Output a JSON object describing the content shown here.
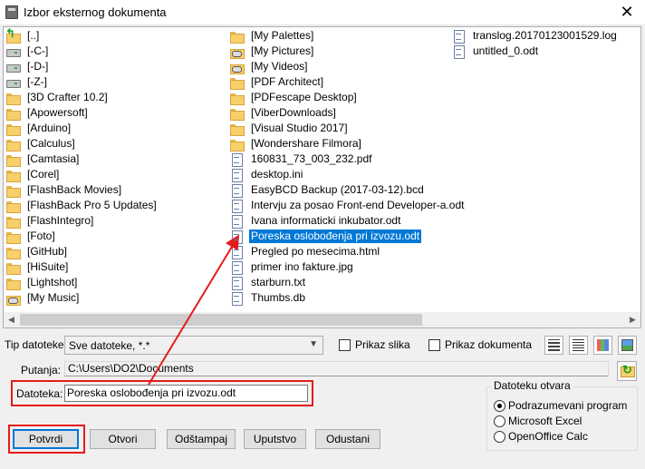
{
  "window": {
    "title": "Izbor eksternog dokumenta",
    "close_glyph": "✕"
  },
  "file_list": {
    "columns": [
      [
        {
          "label": "[..]",
          "icon": "folder-up-icon",
          "kind": "up"
        },
        {
          "label": "[-C-]",
          "icon": "drive-icon",
          "kind": "drive"
        },
        {
          "label": "[-D-]",
          "icon": "drive-icon",
          "kind": "drive"
        },
        {
          "label": "[-Z-]",
          "icon": "drive-icon",
          "kind": "drive"
        },
        {
          "label": "[3D Crafter 10.2]",
          "icon": "folder-icon",
          "kind": "folder"
        },
        {
          "label": "[Apowersoft]",
          "icon": "folder-icon",
          "kind": "folder"
        },
        {
          "label": "[Arduino]",
          "icon": "folder-icon",
          "kind": "folder"
        },
        {
          "label": "[Calculus]",
          "icon": "folder-icon",
          "kind": "folder"
        },
        {
          "label": "[Camtasia]",
          "icon": "folder-icon",
          "kind": "folder"
        },
        {
          "label": "[Corel]",
          "icon": "folder-icon",
          "kind": "folder"
        },
        {
          "label": "[FlashBack Movies]",
          "icon": "folder-icon",
          "kind": "folder"
        },
        {
          "label": "[FlashBack Pro 5 Updates]",
          "icon": "folder-icon",
          "kind": "folder"
        },
        {
          "label": "[FlashIntegro]",
          "icon": "folder-icon",
          "kind": "folder"
        },
        {
          "label": "[Foto]",
          "icon": "folder-icon",
          "kind": "folder"
        },
        {
          "label": "[GitHub]",
          "icon": "folder-icon",
          "kind": "folder"
        },
        {
          "label": "[HiSuite]",
          "icon": "folder-icon",
          "kind": "folder"
        },
        {
          "label": "[Lightshot]",
          "icon": "folder-icon",
          "kind": "folder"
        },
        {
          "label": "[My Music]",
          "icon": "special-folder-icon",
          "kind": "special"
        }
      ],
      [
        {
          "label": "[My Palettes]",
          "icon": "folder-icon",
          "kind": "folder"
        },
        {
          "label": "[My Pictures]",
          "icon": "special-folder-icon",
          "kind": "special"
        },
        {
          "label": "[My Videos]",
          "icon": "special-folder-icon",
          "kind": "special"
        },
        {
          "label": "[PDF Architect]",
          "icon": "folder-icon",
          "kind": "folder"
        },
        {
          "label": "[PDFescape Desktop]",
          "icon": "folder-icon",
          "kind": "folder"
        },
        {
          "label": "[ViberDownloads]",
          "icon": "folder-icon",
          "kind": "folder"
        },
        {
          "label": "[Visual Studio 2017]",
          "icon": "folder-icon",
          "kind": "folder"
        },
        {
          "label": "[Wondershare Filmora]",
          "icon": "folder-icon",
          "kind": "folder"
        },
        {
          "label": "160831_73_003_232.pdf",
          "icon": "file-icon",
          "kind": "file"
        },
        {
          "label": "desktop.ini",
          "icon": "file-icon",
          "kind": "file"
        },
        {
          "label": "EasyBCD Backup (2017-03-12).bcd",
          "icon": "file-icon",
          "kind": "file"
        },
        {
          "label": "Intervju za posao Front-end Developer-a.odt",
          "icon": "file-icon",
          "kind": "file"
        },
        {
          "label": "Ivana informaticki inkubator.odt",
          "icon": "file-icon",
          "kind": "file"
        },
        {
          "label": "Poreska oslobođenja pri izvozu.odt",
          "icon": "file-icon",
          "kind": "file",
          "selected": true
        },
        {
          "label": "Pregled po mesecima.html",
          "icon": "file-icon",
          "kind": "file"
        },
        {
          "label": "primer ino fakture.jpg",
          "icon": "file-icon",
          "kind": "file"
        },
        {
          "label": "starburn.txt",
          "icon": "file-icon",
          "kind": "file"
        },
        {
          "label": "Thumbs.db",
          "icon": "file-icon",
          "kind": "file"
        }
      ],
      [
        {
          "label": "translog.20170123001529.log",
          "icon": "file-icon",
          "kind": "file"
        },
        {
          "label": "untitled_0.odt",
          "icon": "file-icon",
          "kind": "file"
        }
      ]
    ],
    "scroll_left_glyph": "◀",
    "scroll_right_glyph": "▶"
  },
  "file_type": {
    "label": "Tip datoteke:",
    "value": "Sve datoteke, *.*",
    "arrow_glyph": "▼"
  },
  "checkboxes": {
    "preview_image": "Prikaz slika",
    "preview_document": "Prikaz dokumenta"
  },
  "view_buttons": [
    "details-view-icon",
    "list-view-icon",
    "thumbnail-view-icon",
    "image-view-icon"
  ],
  "path": {
    "label": "Putanja:",
    "value": "C:\\Users\\DO2\\Documents"
  },
  "filename": {
    "label": "Datoteka:",
    "value": "Poreska oslobođenja pri izvozu.odt"
  },
  "open_with": {
    "legend": "Datoteku otvara",
    "options": [
      "Podrazumevani program",
      "Microsoft Excel",
      "OpenOffice Calc"
    ],
    "selected_index": 0
  },
  "buttons": {
    "confirm": "Potvrdi",
    "open": "Otvori",
    "print": "Odštampaj",
    "help": "Uputstvo",
    "cancel": "Odustani"
  },
  "colors": {
    "selection": "#0078d7",
    "highlight": "#e51b1b"
  }
}
